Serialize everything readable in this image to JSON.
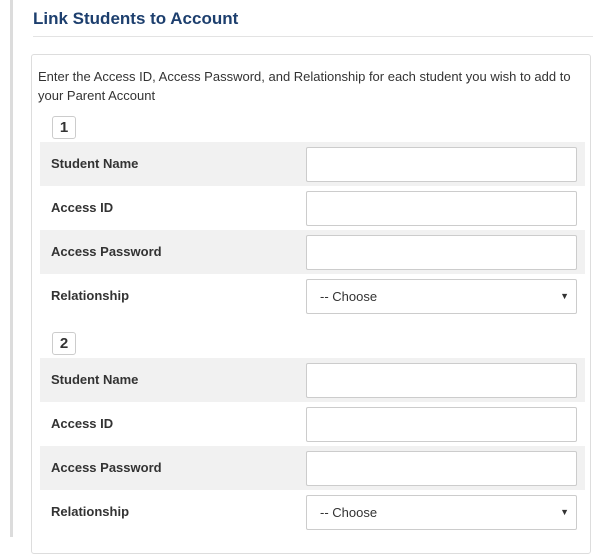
{
  "page": {
    "title": "Link Students to Account",
    "intro": "Enter the Access ID, Access Password, and Relationship for each student you wish to add to your Parent Account"
  },
  "students": [
    {
      "number": "1",
      "student_name_label": "Student Name",
      "student_name_value": "",
      "access_id_label": "Access ID",
      "access_id_value": "",
      "access_password_label": "Access Password",
      "access_password_value": "",
      "relationship_label": "Relationship",
      "relationship_value": "-- Choose",
      "caret_icon": "chevron-down-icon"
    },
    {
      "number": "2",
      "student_name_label": "Student Name",
      "student_name_value": "",
      "access_id_label": "Access ID",
      "access_id_value": "",
      "access_password_label": "Access Password",
      "access_password_value": "",
      "relationship_label": "Relationship",
      "relationship_value": "-- Choose",
      "caret_icon": "chevron-down-icon"
    }
  ],
  "colors": {
    "title": "#1d3f6e",
    "row_shade": "#f1f1f1",
    "border": "#cccccc"
  }
}
